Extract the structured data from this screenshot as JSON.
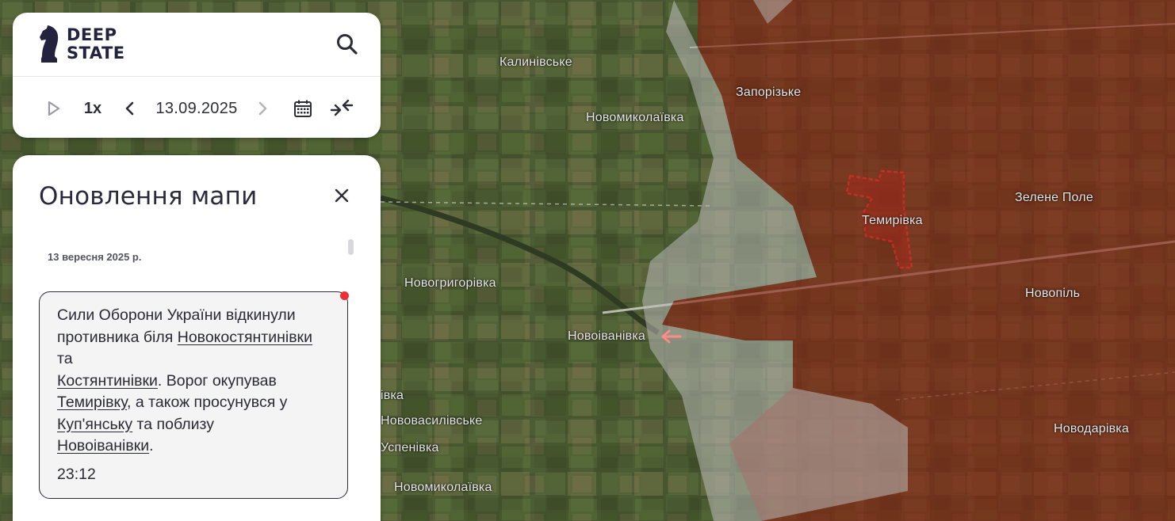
{
  "map": {
    "settlements": [
      {
        "name": "Калинівське"
      },
      {
        "name": "Новомиколаївка"
      },
      {
        "name": "Запорізьке"
      },
      {
        "name": "Зелене Поле"
      },
      {
        "name": "Темирівка"
      },
      {
        "name": "Новогригорівка"
      },
      {
        "name": "Новопіль"
      },
      {
        "name": "Новоіванівка"
      },
      {
        "name": "Новодарівка"
      },
      {
        "name": "івка"
      },
      {
        "name": "Нововасилівське"
      },
      {
        "name": "Успенівка"
      },
      {
        "name": "Новомиколаївка"
      }
    ],
    "colors": {
      "occupied": "#8a1e12",
      "gray_zone": "#b9b9b9",
      "highlight_border": "#ff2b2b",
      "advance_arrow": "#ff8a8a"
    }
  },
  "header": {
    "logo_line1": "DEEP",
    "logo_line2": "STATE",
    "logo_icon": "knight-chess-icon",
    "search_icon": "search-icon"
  },
  "timeline": {
    "play_icon": "play-icon",
    "speed": "1x",
    "prev_icon": "chevron-left-icon",
    "date": "13.09.2025",
    "next_icon": "chevron-right-icon",
    "calendar_icon": "calendar-icon",
    "compare_icon": "collapse-arrows-icon"
  },
  "updates": {
    "title": "Оновлення мапи",
    "close_icon": "close-icon",
    "date_heading": "13 вересня 2025 р.",
    "items": [
      {
        "text_1": "Сили Оборони України відкинули противника біля ",
        "link_1": "Новокостянтинівки",
        "text_2": " та ",
        "link_2": "Костянтинівки",
        "text_3": ". Ворог окупував ",
        "link_3": "Темирівку",
        "text_4": ", а також просунувся у ",
        "link_4": "Куп'янську",
        "text_5": " та поблизу ",
        "link_5": "Новоіванівки",
        "text_6": ".",
        "time": "23:12",
        "unread": true
      }
    ]
  }
}
